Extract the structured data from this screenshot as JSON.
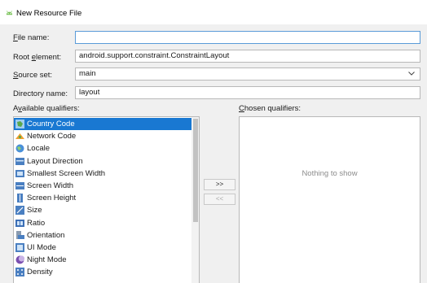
{
  "window": {
    "title": "New Resource File",
    "icon": "android-icon"
  },
  "form": {
    "file_name": {
      "label": "File name:",
      "value": ""
    },
    "root_element": {
      "label": "Root element:",
      "value": "android.support.constraint.ConstraintLayout"
    },
    "source_set": {
      "label": "Source set:",
      "value": "main",
      "icon": "chevron-down-icon"
    },
    "directory_name": {
      "label": "Directory name:",
      "value": "layout"
    }
  },
  "available": {
    "label": "Available qualifiers:",
    "selected_index": 0,
    "items": [
      {
        "label": "Country Code",
        "icon": "country-code-icon"
      },
      {
        "label": "Network Code",
        "icon": "network-code-icon"
      },
      {
        "label": "Locale",
        "icon": "locale-icon"
      },
      {
        "label": "Layout Direction",
        "icon": "layout-direction-icon"
      },
      {
        "label": "Smallest Screen Width",
        "icon": "smallest-screen-width-icon"
      },
      {
        "label": "Screen Width",
        "icon": "screen-width-icon"
      },
      {
        "label": "Screen Height",
        "icon": "screen-height-icon"
      },
      {
        "label": "Size",
        "icon": "size-icon"
      },
      {
        "label": "Ratio",
        "icon": "ratio-icon"
      },
      {
        "label": "Orientation",
        "icon": "orientation-icon"
      },
      {
        "label": "UI Mode",
        "icon": "ui-mode-icon"
      },
      {
        "label": "Night Mode",
        "icon": "night-mode-icon"
      },
      {
        "label": "Density",
        "icon": "density-icon"
      }
    ]
  },
  "buttons": {
    "add": ">>",
    "remove": "<<"
  },
  "chosen": {
    "label": "Chosen qualifiers:",
    "empty_text": "Nothing to show"
  },
  "colors": {
    "selection": "#1978d2",
    "focus_border": "#5a9bd8",
    "android_green": "#78c257"
  }
}
